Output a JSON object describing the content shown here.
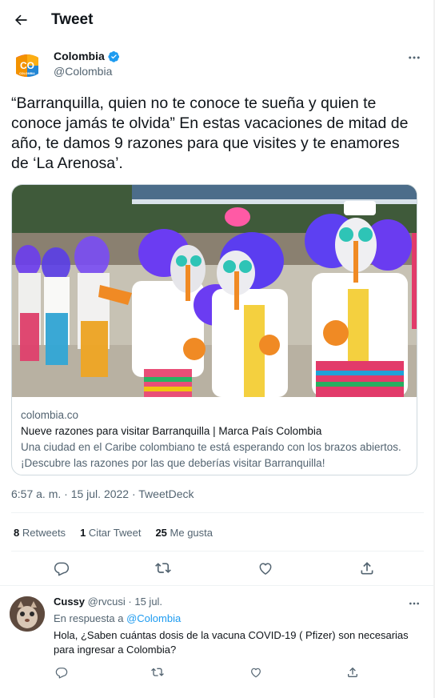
{
  "header": {
    "title": "Tweet",
    "back_icon": "arrow-left-icon"
  },
  "author": {
    "name": "Colombia",
    "handle": "@Colombia",
    "avatar_text": "CO",
    "avatar_subtext": "COLOMBIA",
    "verified": true,
    "verified_color": "#1d9bf0"
  },
  "tweet": {
    "text": "“Barranquilla, quien no te conoce te sueña y quien te conoce jamás te olvida” En estas vacaciones de mitad de año, te damos 9 razones para que visites y te enamores de ‘La Arenosa’.",
    "timestamp": "6:57 a. m. · 15 jul. 2022 · TweetDeck"
  },
  "card": {
    "domain": "colombia.co",
    "title": "Nueve razones para visitar Barranquilla | Marca País Colombia",
    "description": "Una ciudad en el Caribe colombiano te está esperando con los brazos abiertos. ¡Descubre las razones por las que deberías visitar Barranquilla!"
  },
  "stats": [
    {
      "count": "8",
      "label": "Retweets"
    },
    {
      "count": "1",
      "label": "Citar Tweet"
    },
    {
      "count": "25",
      "label": "Me gusta"
    }
  ],
  "actions": [
    "reply-icon",
    "retweet-icon",
    "like-icon",
    "share-icon"
  ],
  "reply": {
    "name": "Cussy",
    "meta": "@rvcusi · 15 jul.",
    "replying_prefix": "En respuesta a",
    "replying_to": "@Colombia",
    "text": "Hola, ¿Saben cuántas dosis de la vacuna COVID-19 ( Pfizer) son necesarias para ingresar a Colombia?"
  },
  "colors": {
    "accent": "#1d9bf0",
    "secondary_text": "#536471",
    "border": "#cfd9de"
  }
}
